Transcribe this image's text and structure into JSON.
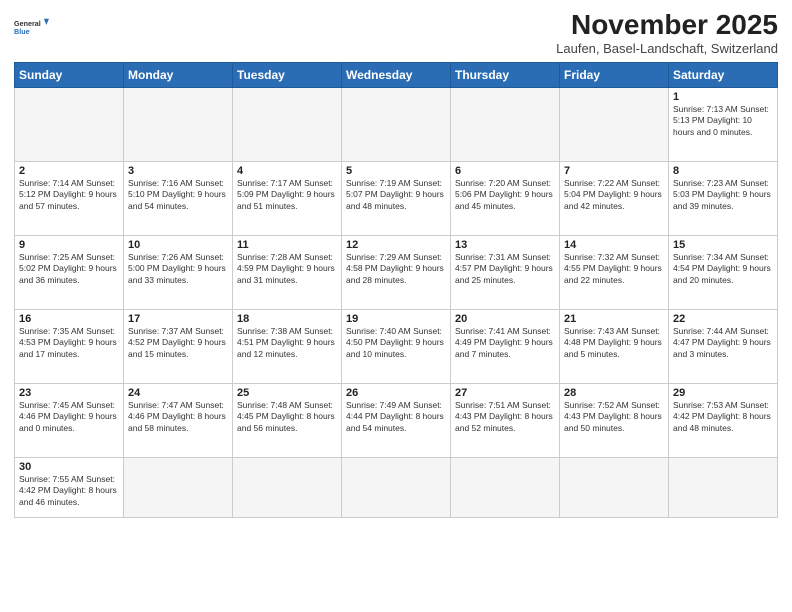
{
  "logo": {
    "line1": "General",
    "line2": "Blue"
  },
  "title": "November 2025",
  "subtitle": "Laufen, Basel-Landschaft, Switzerland",
  "days_of_week": [
    "Sunday",
    "Monday",
    "Tuesday",
    "Wednesday",
    "Thursday",
    "Friday",
    "Saturday"
  ],
  "weeks": [
    [
      {
        "day": "",
        "info": "",
        "empty": true
      },
      {
        "day": "",
        "info": "",
        "empty": true
      },
      {
        "day": "",
        "info": "",
        "empty": true
      },
      {
        "day": "",
        "info": "",
        "empty": true
      },
      {
        "day": "",
        "info": "",
        "empty": true
      },
      {
        "day": "",
        "info": "",
        "empty": true
      },
      {
        "day": "1",
        "info": "Sunrise: 7:13 AM\nSunset: 5:13 PM\nDaylight: 10 hours\nand 0 minutes."
      }
    ],
    [
      {
        "day": "2",
        "info": "Sunrise: 7:14 AM\nSunset: 5:12 PM\nDaylight: 9 hours\nand 57 minutes."
      },
      {
        "day": "3",
        "info": "Sunrise: 7:16 AM\nSunset: 5:10 PM\nDaylight: 9 hours\nand 54 minutes."
      },
      {
        "day": "4",
        "info": "Sunrise: 7:17 AM\nSunset: 5:09 PM\nDaylight: 9 hours\nand 51 minutes."
      },
      {
        "day": "5",
        "info": "Sunrise: 7:19 AM\nSunset: 5:07 PM\nDaylight: 9 hours\nand 48 minutes."
      },
      {
        "day": "6",
        "info": "Sunrise: 7:20 AM\nSunset: 5:06 PM\nDaylight: 9 hours\nand 45 minutes."
      },
      {
        "day": "7",
        "info": "Sunrise: 7:22 AM\nSunset: 5:04 PM\nDaylight: 9 hours\nand 42 minutes."
      },
      {
        "day": "8",
        "info": "Sunrise: 7:23 AM\nSunset: 5:03 PM\nDaylight: 9 hours\nand 39 minutes."
      }
    ],
    [
      {
        "day": "9",
        "info": "Sunrise: 7:25 AM\nSunset: 5:02 PM\nDaylight: 9 hours\nand 36 minutes."
      },
      {
        "day": "10",
        "info": "Sunrise: 7:26 AM\nSunset: 5:00 PM\nDaylight: 9 hours\nand 33 minutes."
      },
      {
        "day": "11",
        "info": "Sunrise: 7:28 AM\nSunset: 4:59 PM\nDaylight: 9 hours\nand 31 minutes."
      },
      {
        "day": "12",
        "info": "Sunrise: 7:29 AM\nSunset: 4:58 PM\nDaylight: 9 hours\nand 28 minutes."
      },
      {
        "day": "13",
        "info": "Sunrise: 7:31 AM\nSunset: 4:57 PM\nDaylight: 9 hours\nand 25 minutes."
      },
      {
        "day": "14",
        "info": "Sunrise: 7:32 AM\nSunset: 4:55 PM\nDaylight: 9 hours\nand 22 minutes."
      },
      {
        "day": "15",
        "info": "Sunrise: 7:34 AM\nSunset: 4:54 PM\nDaylight: 9 hours\nand 20 minutes."
      }
    ],
    [
      {
        "day": "16",
        "info": "Sunrise: 7:35 AM\nSunset: 4:53 PM\nDaylight: 9 hours\nand 17 minutes."
      },
      {
        "day": "17",
        "info": "Sunrise: 7:37 AM\nSunset: 4:52 PM\nDaylight: 9 hours\nand 15 minutes."
      },
      {
        "day": "18",
        "info": "Sunrise: 7:38 AM\nSunset: 4:51 PM\nDaylight: 9 hours\nand 12 minutes."
      },
      {
        "day": "19",
        "info": "Sunrise: 7:40 AM\nSunset: 4:50 PM\nDaylight: 9 hours\nand 10 minutes."
      },
      {
        "day": "20",
        "info": "Sunrise: 7:41 AM\nSunset: 4:49 PM\nDaylight: 9 hours\nand 7 minutes."
      },
      {
        "day": "21",
        "info": "Sunrise: 7:43 AM\nSunset: 4:48 PM\nDaylight: 9 hours\nand 5 minutes."
      },
      {
        "day": "22",
        "info": "Sunrise: 7:44 AM\nSunset: 4:47 PM\nDaylight: 9 hours\nand 3 minutes."
      }
    ],
    [
      {
        "day": "23",
        "info": "Sunrise: 7:45 AM\nSunset: 4:46 PM\nDaylight: 9 hours\nand 0 minutes."
      },
      {
        "day": "24",
        "info": "Sunrise: 7:47 AM\nSunset: 4:46 PM\nDaylight: 8 hours\nand 58 minutes."
      },
      {
        "day": "25",
        "info": "Sunrise: 7:48 AM\nSunset: 4:45 PM\nDaylight: 8 hours\nand 56 minutes."
      },
      {
        "day": "26",
        "info": "Sunrise: 7:49 AM\nSunset: 4:44 PM\nDaylight: 8 hours\nand 54 minutes."
      },
      {
        "day": "27",
        "info": "Sunrise: 7:51 AM\nSunset: 4:43 PM\nDaylight: 8 hours\nand 52 minutes."
      },
      {
        "day": "28",
        "info": "Sunrise: 7:52 AM\nSunset: 4:43 PM\nDaylight: 8 hours\nand 50 minutes."
      },
      {
        "day": "29",
        "info": "Sunrise: 7:53 AM\nSunset: 4:42 PM\nDaylight: 8 hours\nand 48 minutes."
      }
    ],
    [
      {
        "day": "30",
        "info": "Sunrise: 7:55 AM\nSunset: 4:42 PM\nDaylight: 8 hours\nand 46 minutes."
      },
      {
        "day": "",
        "info": "",
        "empty": true
      },
      {
        "day": "",
        "info": "",
        "empty": true
      },
      {
        "day": "",
        "info": "",
        "empty": true
      },
      {
        "day": "",
        "info": "",
        "empty": true
      },
      {
        "day": "",
        "info": "",
        "empty": true
      },
      {
        "day": "",
        "info": "",
        "empty": true
      }
    ]
  ]
}
